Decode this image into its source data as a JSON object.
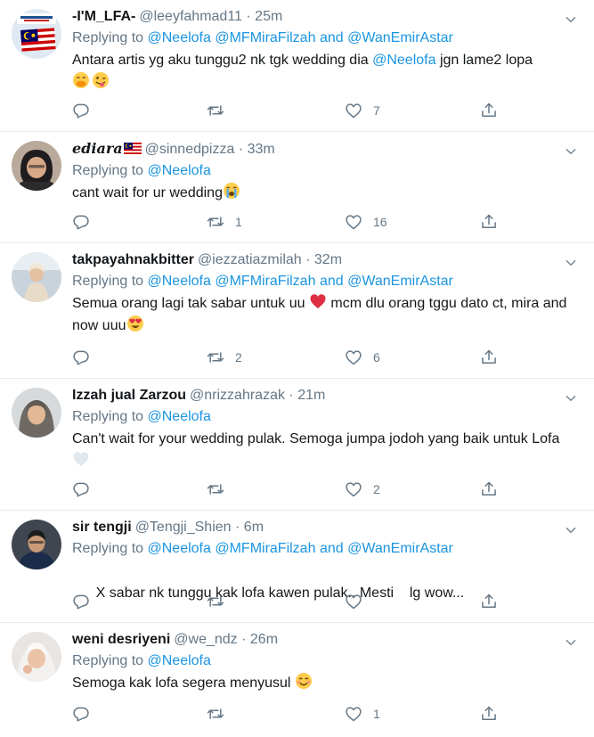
{
  "tweets": [
    {
      "name": "-I'M_LFA-",
      "handle": "@leeyfahmad11",
      "time": "25m",
      "replying_label": "Replying to",
      "mentions": [
        "@Neelofa",
        "@MFMiraFilzah"
      ],
      "and_label": "and",
      "last_mention": "@WanEmirAstar",
      "text_1": "Antara artis yg aku tunggu2 nk tgk wedding dia",
      "text_mention": "@Neelofa",
      "text_2": "jgn lame2 lopa",
      "emojis": [
        "hand-over-mouth-emoji",
        "winking-tongue-emoji"
      ],
      "replies": "",
      "retweets": "",
      "likes": "7"
    },
    {
      "name": "ediara",
      "handle": "@sinnedpizza",
      "time": "33m",
      "replying_label": "Replying to",
      "mentions": [
        "@Neelofa"
      ],
      "text": "cant wait for ur wedding",
      "emoji": "loudly-crying-emoji",
      "replies": "",
      "retweets": "1",
      "likes": "16"
    },
    {
      "name": "takpayahnakbitter",
      "handle": "@iezzatiazmilah",
      "time": "32m",
      "replying_label": "Replying to",
      "mentions": [
        "@Neelofa",
        "@MFMiraFilzah"
      ],
      "and_label": "and",
      "last_mention": "@WanEmirAstar",
      "text_1": "Semua orang lagi tak sabar untuk uu",
      "text_2": "mcm dlu orang tggu dato ct, mira and now uuu",
      "emojis": [
        "red-heart-emoji",
        "heart-eyes-emoji"
      ],
      "replies": "",
      "retweets": "2",
      "likes": "6"
    },
    {
      "name": "Izzah jual Zarzou",
      "handle": "@nrizzahrazak",
      "time": "21m",
      "replying_label": "Replying to",
      "mentions": [
        "@Neelofa"
      ],
      "text": "Can't wait for your wedding pulak. Semoga jumpa jodoh yang baik untuk Lofa",
      "emoji": "white-heart-emoji",
      "replies": "",
      "retweets": "",
      "likes": "2"
    },
    {
      "name": "sir tengji",
      "handle": "@Tengji_Shien",
      "time": "6m",
      "replying_label": "Replying to",
      "mentions": [
        "@Neelofa",
        "@MFMiraFilzah"
      ],
      "and_label": "and",
      "last_mention": "@WanEmirAstar",
      "text": "X sabar nk tunggu kak lofa kawen pulak.. Mesti    lg wow...",
      "replies": "",
      "retweets": "",
      "likes": ""
    },
    {
      "name": "weni desriyeni",
      "handle": "@we_ndz",
      "time": "26m",
      "replying_label": "Replying to",
      "mentions": [
        "@Neelofa"
      ],
      "text": "Semoga kak lofa segera menyusul",
      "emoji": "smiling-face-emoji",
      "replies": "",
      "retweets": "",
      "likes": "1"
    }
  ],
  "separator": "·",
  "colors": {
    "text": "#14171a",
    "muted": "#657786",
    "link": "#1b95e0",
    "border": "#e6ecf0"
  }
}
